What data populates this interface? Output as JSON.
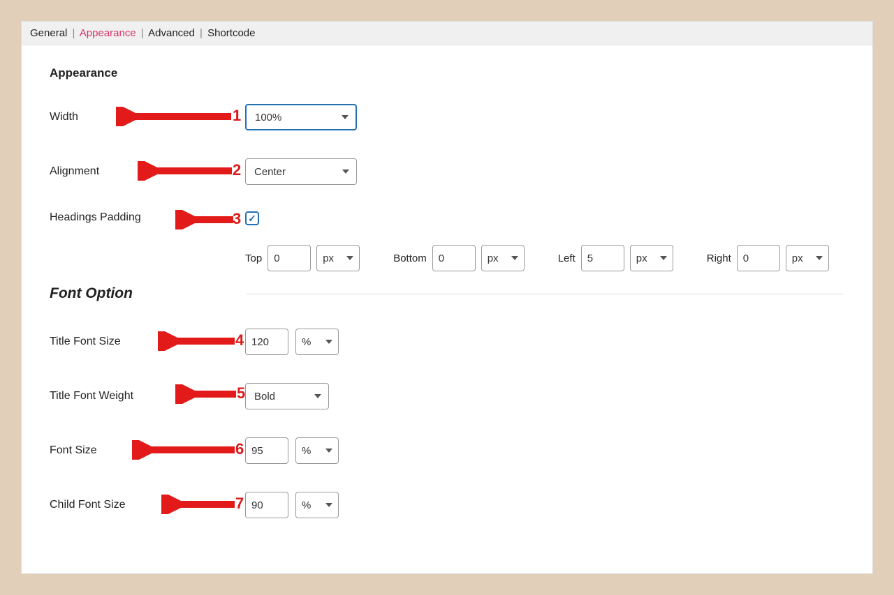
{
  "tabs": {
    "general": "General",
    "appearance": "Appearance",
    "advanced": "Advanced",
    "shortcode": "Shortcode"
  },
  "section": {
    "appearance": "Appearance",
    "font_option": "Font Option"
  },
  "labels": {
    "width": "Width",
    "alignment": "Alignment",
    "headings_padding": "Headings Padding",
    "title_font_size": "Title Font Size",
    "title_font_weight": "Title Font Weight",
    "font_size": "Font Size",
    "child_font_size": "Child Font Size"
  },
  "values": {
    "width": "100%",
    "alignment": "Center",
    "headings_padding_checked": true,
    "title_font_size": "120",
    "title_font_size_unit": "%",
    "title_font_weight": "Bold",
    "font_size": "95",
    "font_size_unit": "%",
    "child_font_size": "90",
    "child_font_size_unit": "%"
  },
  "padding": {
    "top_label": "Top",
    "top": "0",
    "top_unit": "px",
    "bottom_label": "Bottom",
    "bottom": "0",
    "bottom_unit": "px",
    "left_label": "Left",
    "left": "5",
    "left_unit": "px",
    "right_label": "Right",
    "right": "0",
    "right_unit": "px"
  },
  "annotations": {
    "n1": "1",
    "n2": "2",
    "n3": "3",
    "n4": "4",
    "n5": "5",
    "n6": "6",
    "n7": "7"
  }
}
